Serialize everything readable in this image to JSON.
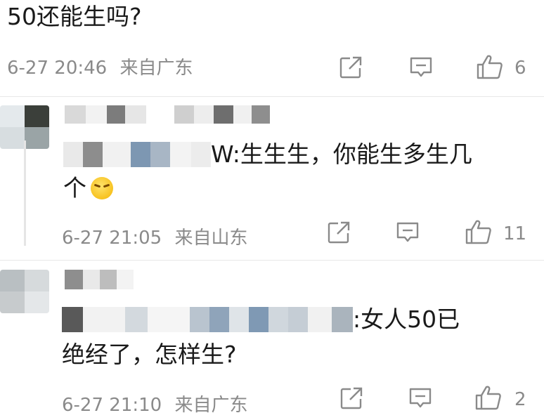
{
  "top_comment": {
    "text": "50还能生吗?",
    "timestamp": "6-27 20:46",
    "location": "来自广东",
    "like_count": "6"
  },
  "reply1": {
    "mention_suffix": "W:",
    "text_line1": "生生生，你能生多生几",
    "text_line2": "个",
    "emoji_name": "grimace-emoji",
    "timestamp": "6-27 21:05",
    "location": "来自山东",
    "like_count": "11"
  },
  "reply2": {
    "mention_suffix": ":",
    "text_line1": "女人50已",
    "text_line2": "绝经了，怎样生?",
    "timestamp": "6-27 21:10",
    "location": "来自广东",
    "like_count": "2"
  },
  "icons": {
    "share": "share-icon",
    "comment": "comment-icon",
    "like": "thumbs-up-icon"
  }
}
